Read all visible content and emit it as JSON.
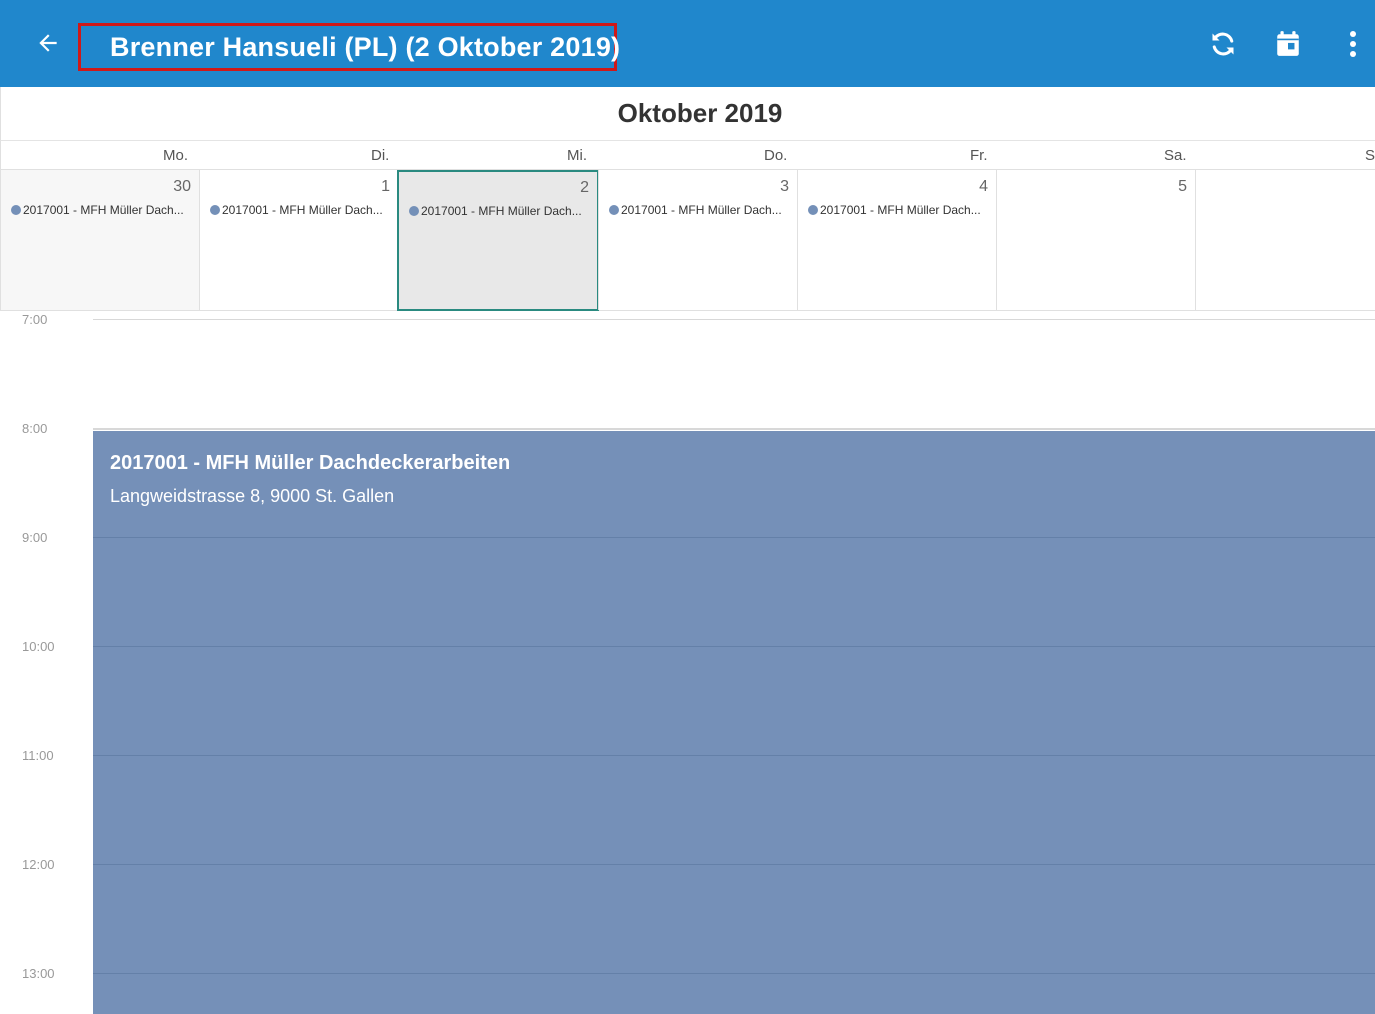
{
  "topbar": {
    "back_icon": "arrow-left-icon",
    "title": "Brenner Hansueli (PL) (2 Oktober 2019)",
    "refresh_icon": "refresh-icon",
    "calendar_icon": "calendar-today-icon",
    "menu_icon": "more-vertical-icon",
    "bg_color": "#2087cc",
    "highlight_color": "#d01818"
  },
  "month": {
    "title": "Oktober 2019"
  },
  "weekdays": [
    "Mo.",
    "Di.",
    "Mi.",
    "Do.",
    "Fr.",
    "Sa.",
    "So."
  ],
  "days": [
    {
      "number": "30",
      "event": "2017001 - MFH Müller Dach..."
    },
    {
      "number": "1",
      "event": "2017001 - MFH Müller Dach..."
    },
    {
      "number": "2",
      "event": "2017001 - MFH Müller Dach..."
    },
    {
      "number": "3",
      "event": "2017001 - MFH Müller Dach..."
    },
    {
      "number": "4",
      "event": "2017001 - MFH Müller Dach..."
    },
    {
      "number": "5",
      "event": ""
    },
    {
      "number": "",
      "event": ""
    }
  ],
  "selected_day": "2",
  "hours": [
    "7:00",
    "8:00",
    "9:00",
    "10:00",
    "11:00",
    "12:00",
    "13:00"
  ],
  "event": {
    "title": "2017001 - MFH Müller Dachdeckerarbeiten",
    "address": "Langweidstrasse 8, 9000 St. Gallen",
    "color": "#7590b8"
  }
}
